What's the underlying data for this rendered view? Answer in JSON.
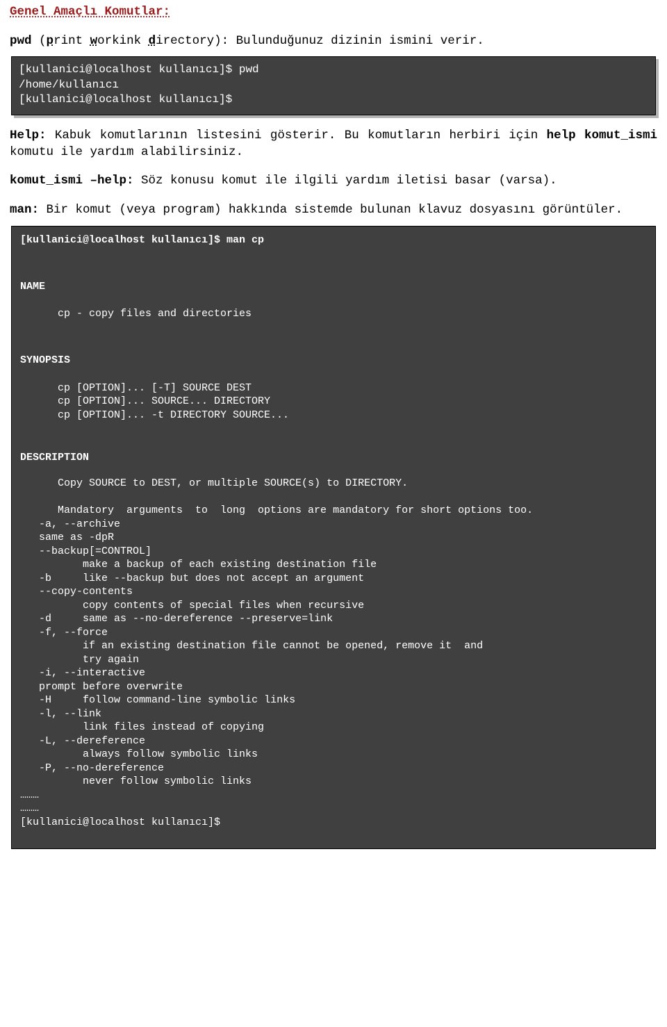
{
  "heading": "Genel Amaçlı Komutlar:",
  "p1": {
    "strong1": "pwd",
    "paren_open": "(",
    "p_letter": "p",
    "rint": "rint ",
    "w_letter": "w",
    "orkink_rest": "orkink ",
    "d_letter": "d",
    "irectory_rest": "irectory): Bulunduğunuz dizinin ismini verir."
  },
  "box1": {
    "l1": "[kullanici@localhost kullanıcı]$ pwd",
    "l2": "/home/kullanıcı",
    "l3": "[kullanici@localhost kullanıcı]$"
  },
  "p2": {
    "help": "Help:",
    "t1": " Kabuk komutlarının listesini gösterir. Bu komutların herbiri için ",
    "helpk": "help komut_ismi",
    "t2": " komutu ile yardım alabilirsiniz."
  },
  "p3": {
    "ki": "komut_ismi –help:",
    "rest": " Söz konusu komut ile ilgili yardım iletisi basar (varsa)."
  },
  "p4": {
    "man": "man:",
    "rest": " Bir komut (veya program) hakkında sistemde bulunan klavuz dosyasını görüntüler."
  },
  "box2": {
    "cmd": "[kullanici@localhost kullanıcı]$ man cp",
    "sec_name": "NAME",
    "name_line": "cp - copy files and directories",
    "sec_syn": "SYNOPSIS",
    "syn1": "cp [OPTION]... [-T] SOURCE DEST",
    "syn2": "cp [OPTION]... SOURCE... DIRECTORY",
    "syn3": "cp [OPTION]... -t DIRECTORY SOURCE...",
    "sec_desc": "DESCRIPTION",
    "d1": "Copy SOURCE to DEST, or multiple SOURCE(s) to DIRECTORY.",
    "d2": "Mandatory  arguments  to  long  options are mandatory for short options too.",
    "opt_a": "   -a, --archive",
    "opt_a2": "   same as -dpR",
    "opt_backup": "   --backup[=CONTROL]",
    "opt_backup2": "          make a backup of each existing destination file",
    "opt_b": "   -b     like --backup but does not accept an argument",
    "opt_cc": "   --copy-contents",
    "opt_cc2": "          copy contents of special files when recursive",
    "opt_d": "   -d     same as --no-dereference --preserve=link",
    "opt_f": "   -f, --force",
    "opt_f2": "          if an existing destination file cannot be opened, remove it  and",
    "opt_f3": "          try again",
    "opt_i": "   -i, --interactive",
    "opt_i2": "   prompt before overwrite",
    "opt_H": "   -H     follow command-line symbolic links",
    "opt_l": "   -l, --link",
    "opt_l2": "          link files instead of copying",
    "opt_L": "   -L, --dereference",
    "opt_L2": "          always follow symbolic links",
    "opt_P": "   -P, --no-dereference",
    "opt_P2": "          never follow symbolic links",
    "dots1": "………",
    "dots2": "………",
    "prompt": "[kullanici@localhost kullanıcı]$"
  }
}
